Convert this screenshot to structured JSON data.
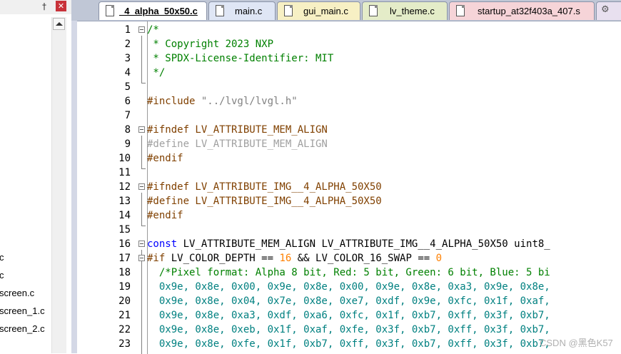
{
  "left_panel": {
    "pin_glyph": "📌",
    "close_glyph": "✕",
    "files": [
      "c",
      "c",
      "screen.c",
      "screen_1.c",
      "screen_2.c"
    ]
  },
  "tabs": [
    {
      "label": "_4_alpha_50x50.c",
      "active": true,
      "color": "#ffffff"
    },
    {
      "label": "main.c",
      "active": false,
      "color": "#dfe6f5"
    },
    {
      "label": "gui_main.c",
      "active": false,
      "color": "#f7f0c4"
    },
    {
      "label": "lv_theme.c",
      "active": false,
      "color": "#e4ecc8"
    },
    {
      "label": "startup_at32f403a_407.s",
      "active": false,
      "color": "#f6d4d8"
    },
    {
      "label": "",
      "active": false,
      "color": "#e8e0ef"
    }
  ],
  "editor": {
    "line_numbers": [
      "1",
      "2",
      "3",
      "4",
      "5",
      "6",
      "7",
      "8",
      "9",
      "10",
      "11",
      "12",
      "13",
      "14",
      "15",
      "16",
      "17",
      "18",
      "19",
      "20",
      "21",
      "22",
      "23"
    ],
    "lines": [
      "/*",
      " * Copyright 2023 NXP",
      " * SPDX-License-Identifier: MIT",
      " */",
      "",
      "#include \"../lvgl/lvgl.h\"",
      "",
      "#ifndef LV_ATTRIBUTE_MEM_ALIGN",
      "#define LV_ATTRIBUTE_MEM_ALIGN",
      "#endif",
      "",
      "#ifndef LV_ATTRIBUTE_IMG__4_ALPHA_50X50",
      "#define LV_ATTRIBUTE_IMG__4_ALPHA_50X50",
      "#endif",
      "",
      "const LV_ATTRIBUTE_MEM_ALIGN LV_ATTRIBUTE_IMG__4_ALPHA_50X50 uint8_",
      "#if LV_COLOR_DEPTH == 16 && LV_COLOR_16_SWAP == 0",
      "  /*Pixel format: Alpha 8 bit, Red: 5 bit, Green: 6 bit, Blue: 5 bi",
      "  0x9e, 0x8e, 0x00, 0x9e, 0x8e, 0x00, 0x9e, 0x8e, 0xa3, 0x9e, 0x8e,",
      "  0x9e, 0x8e, 0x04, 0x7e, 0x8e, 0xe7, 0xdf, 0x9e, 0xfc, 0x1f, 0xaf,",
      "  0x9e, 0x8e, 0xa3, 0xdf, 0xa6, 0xfc, 0x1f, 0xb7, 0xff, 0x3f, 0xb7,",
      "  0x9e, 0x8e, 0xeb, 0x1f, 0xaf, 0xfe, 0x3f, 0xb7, 0xff, 0x3f, 0xb7,",
      "  0x9e, 0x8e, 0xfe, 0x1f, 0xb7, 0xff, 0x3f, 0xb7, 0xff, 0x3f, 0xb7,"
    ]
  },
  "watermark": "CSDN @黑色K57"
}
